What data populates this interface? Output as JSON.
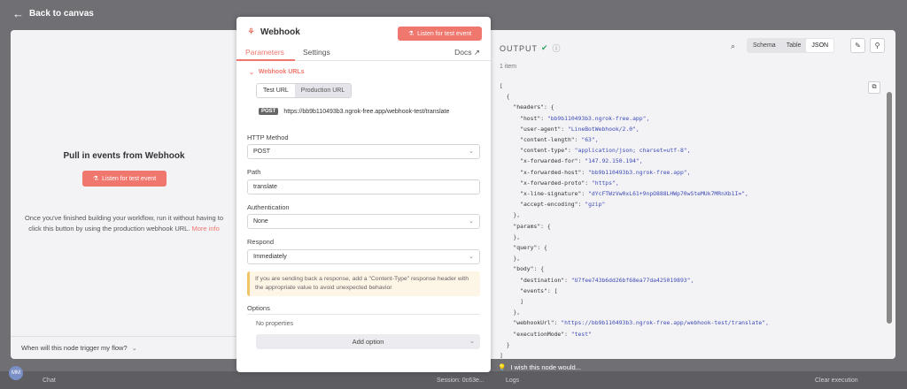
{
  "topbar": {
    "back_label": "Back to canvas"
  },
  "left": {
    "heading": "Pull in events from Webhook",
    "listen_label": "Listen for test event",
    "desc": "Once you've finished building your workflow, run it without having to click this button by using the production webhook URL.",
    "more_info": "More info",
    "trigger_question": "When will this node trigger my flow?"
  },
  "node": {
    "title": "Webhook",
    "listen_label": "Listen for test event",
    "tabs": [
      "Parameters",
      "Settings"
    ],
    "docs_label": "Docs",
    "webhook_urls_label": "Webhook URLs",
    "url_tabs": [
      "Test URL",
      "Production URL"
    ],
    "url_method": "POST",
    "url_value": "https://bb9b110493b3.ngrok-free.app/webhook-test/translate",
    "fields": {
      "http_method": {
        "label": "HTTP Method",
        "value": "POST"
      },
      "path": {
        "label": "Path",
        "value": "translate"
      },
      "authentication": {
        "label": "Authentication",
        "value": "None"
      },
      "respond": {
        "label": "Respond",
        "value": "Immediately"
      }
    },
    "note": "If you are sending back a response, add a \"Content-Type\" response header with the appropriate value to avoid unexpected behavior",
    "options_label": "Options",
    "no_properties": "No properties",
    "add_option": "Add option"
  },
  "output": {
    "title": "OUTPUT",
    "items_count": "1 item",
    "views": [
      "Schema",
      "Table",
      "JSON"
    ],
    "selected_view": "JSON",
    "json_lines": [
      "[",
      "  {",
      "    \"headers\": {",
      "      \"host\": \"bb9b110493b3.ngrok-free.app\",",
      "      \"user-agent\": \"LineBotWebhook/2.0\",",
      "      \"content-length\": \"63\",",
      "      \"content-type\": \"application/json; charset=utf-8\",",
      "      \"x-forwarded-for\": \"147.92.150.194\",",
      "      \"x-forwarded-host\": \"bb9b110493b3.ngrok-free.app\",",
      "      \"x-forwarded-proto\": \"https\",",
      "      \"x-line-signature\": \"dYcFTWzVw0xL61+9npO888LHWp70wSteMUk7MRnXb1I=\",",
      "      \"accept-encoding\": \"gzip\"",
      "    },",
      "    \"params\": {",
      "    },",
      "    \"query\": {",
      "    },",
      "    \"body\": {",
      "      \"destination\": \"U7fee743b6dd26bf68ea77da425019893\",",
      "      \"events\": [",
      "      ]",
      "    },",
      "    \"webhookUrl\": \"https://bb9b110493b3.ngrok-free.app/webhook-test/translate\",",
      "    \"executionMode\": \"test\"",
      "  }",
      "]"
    ],
    "wish_label": "I wish this node would..."
  },
  "background": {
    "chat_label": "Chat",
    "session_label": "Session: 0c63e...",
    "logs_label": "Logs",
    "clear_label": "Clear execution",
    "avatar_initials": "MM"
  },
  "colors": {
    "accent": "#f0776d",
    "success": "#2fa561",
    "json_string": "#3d4bb5"
  }
}
